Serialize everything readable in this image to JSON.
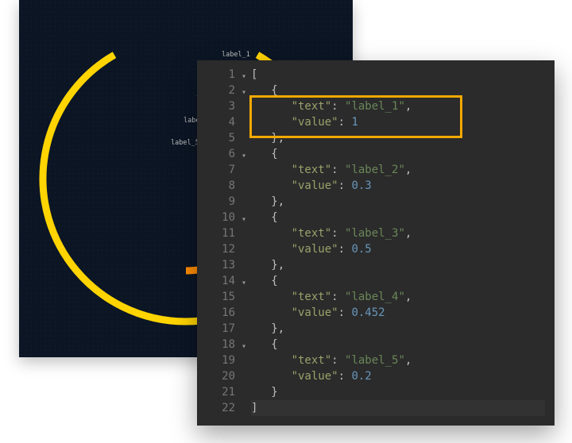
{
  "chart_data": {
    "type": "bar",
    "title": "",
    "series": [
      {
        "text": "label_1",
        "value": 1
      },
      {
        "text": "label_2",
        "value": 0.3
      },
      {
        "text": "label_3",
        "value": 0.5
      },
      {
        "text": "label_4",
        "value": 0.452
      },
      {
        "text": "label_5",
        "value": 0.2
      }
    ],
    "colors": [
      "#ffd400",
      "#ffb800",
      "#ff8c00",
      "#ff5a1f",
      "#ff3b1f"
    ],
    "range": [
      0,
      1
    ]
  },
  "editor": {
    "lines": [
      {
        "n": 1,
        "fold": "▾",
        "tokens": [
          {
            "t": "[",
            "c": "k"
          }
        ]
      },
      {
        "n": 2,
        "fold": "▾",
        "indent": 1,
        "tokens": [
          {
            "t": "{",
            "c": "k"
          }
        ]
      },
      {
        "n": 3,
        "indent": 2,
        "tokens": [
          {
            "t": "\"text\"",
            "c": "key"
          },
          {
            "t": ": ",
            "c": "k"
          },
          {
            "t": "\"label_1\"",
            "c": "str"
          },
          {
            "t": ",",
            "c": "k"
          }
        ]
      },
      {
        "n": 4,
        "indent": 2,
        "tokens": [
          {
            "t": "\"value\"",
            "c": "key"
          },
          {
            "t": ": ",
            "c": "k"
          },
          {
            "t": "1",
            "c": "num"
          }
        ]
      },
      {
        "n": 5,
        "indent": 1,
        "tokens": [
          {
            "t": "},",
            "c": "k"
          }
        ]
      },
      {
        "n": 6,
        "fold": "▾",
        "indent": 1,
        "tokens": [
          {
            "t": "{",
            "c": "k"
          }
        ]
      },
      {
        "n": 7,
        "indent": 2,
        "tokens": [
          {
            "t": "\"text\"",
            "c": "key"
          },
          {
            "t": ": ",
            "c": "k"
          },
          {
            "t": "\"label_2\"",
            "c": "str"
          },
          {
            "t": ",",
            "c": "k"
          }
        ]
      },
      {
        "n": 8,
        "indent": 2,
        "tokens": [
          {
            "t": "\"value\"",
            "c": "key"
          },
          {
            "t": ": ",
            "c": "k"
          },
          {
            "t": "0.3",
            "c": "num"
          }
        ]
      },
      {
        "n": 9,
        "indent": 1,
        "tokens": [
          {
            "t": "},",
            "c": "k"
          }
        ]
      },
      {
        "n": 10,
        "fold": "▾",
        "indent": 1,
        "tokens": [
          {
            "t": "{",
            "c": "k"
          }
        ]
      },
      {
        "n": 11,
        "indent": 2,
        "tokens": [
          {
            "t": "\"text\"",
            "c": "key"
          },
          {
            "t": ": ",
            "c": "k"
          },
          {
            "t": "\"label_3\"",
            "c": "str"
          },
          {
            "t": ",",
            "c": "k"
          }
        ]
      },
      {
        "n": 12,
        "indent": 2,
        "tokens": [
          {
            "t": "\"value\"",
            "c": "key"
          },
          {
            "t": ": ",
            "c": "k"
          },
          {
            "t": "0.5",
            "c": "num"
          }
        ]
      },
      {
        "n": 13,
        "indent": 1,
        "tokens": [
          {
            "t": "},",
            "c": "k"
          }
        ]
      },
      {
        "n": 14,
        "fold": "▾",
        "indent": 1,
        "tokens": [
          {
            "t": "{",
            "c": "k"
          }
        ]
      },
      {
        "n": 15,
        "indent": 2,
        "tokens": [
          {
            "t": "\"text\"",
            "c": "key"
          },
          {
            "t": ": ",
            "c": "k"
          },
          {
            "t": "\"label_4\"",
            "c": "str"
          },
          {
            "t": ",",
            "c": "k"
          }
        ]
      },
      {
        "n": 16,
        "indent": 2,
        "tokens": [
          {
            "t": "\"value\"",
            "c": "key"
          },
          {
            "t": ": ",
            "c": "k"
          },
          {
            "t": "0.452",
            "c": "num"
          }
        ]
      },
      {
        "n": 17,
        "indent": 1,
        "tokens": [
          {
            "t": "},",
            "c": "k"
          }
        ]
      },
      {
        "n": 18,
        "fold": "▾",
        "indent": 1,
        "tokens": [
          {
            "t": "{",
            "c": "k"
          }
        ]
      },
      {
        "n": 19,
        "indent": 2,
        "tokens": [
          {
            "t": "\"text\"",
            "c": "key"
          },
          {
            "t": ": ",
            "c": "k"
          },
          {
            "t": "\"label_5\"",
            "c": "str"
          },
          {
            "t": ",",
            "c": "k"
          }
        ]
      },
      {
        "n": 20,
        "indent": 2,
        "tokens": [
          {
            "t": "\"value\"",
            "c": "key"
          },
          {
            "t": ": ",
            "c": "k"
          },
          {
            "t": "0.2",
            "c": "num"
          }
        ]
      },
      {
        "n": 21,
        "indent": 1,
        "tokens": [
          {
            "t": "}",
            "c": "k"
          }
        ]
      },
      {
        "n": 22,
        "selected": true,
        "tokens": [
          {
            "t": "]",
            "c": "k"
          }
        ]
      }
    ],
    "highlight_lines": [
      3,
      4
    ]
  }
}
